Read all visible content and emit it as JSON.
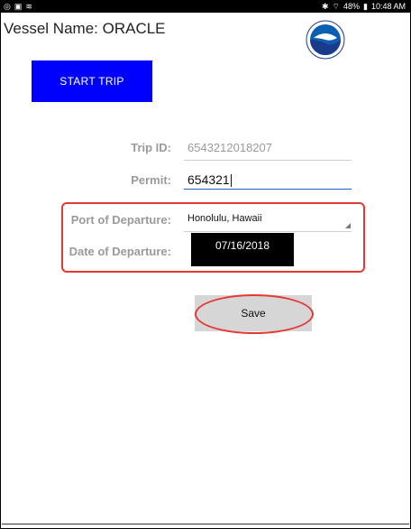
{
  "status_bar": {
    "left_icons": [
      "target-icon",
      "image-icon",
      "wifi-icon"
    ],
    "bluetooth_icon": "bluetooth-icon",
    "signal_icon": "signal-icon",
    "battery_text": "48%",
    "battery_icon": "battery-icon",
    "time": "10:48 AM"
  },
  "header": {
    "vessel_label": "Vessel Name: ORACLE",
    "logo": "noaa-logo",
    "start_button": "START TRIP"
  },
  "form": {
    "trip_id_label": "Trip ID:",
    "trip_id_value": "6543212018207",
    "permit_label": "Permit:",
    "permit_value": "654321",
    "port_label": "Port of Departure:",
    "port_value": "Honolulu, Hawaii",
    "date_label": "Date of Departure:",
    "date_value": "07/16/2018"
  },
  "actions": {
    "save_label": "Save"
  },
  "colors": {
    "start_button_bg": "#0000ff",
    "highlight": "#e53935",
    "date_box_bg": "#000000",
    "save_bg": "#d6d6d6",
    "status_bar_bg": "#000000"
  }
}
